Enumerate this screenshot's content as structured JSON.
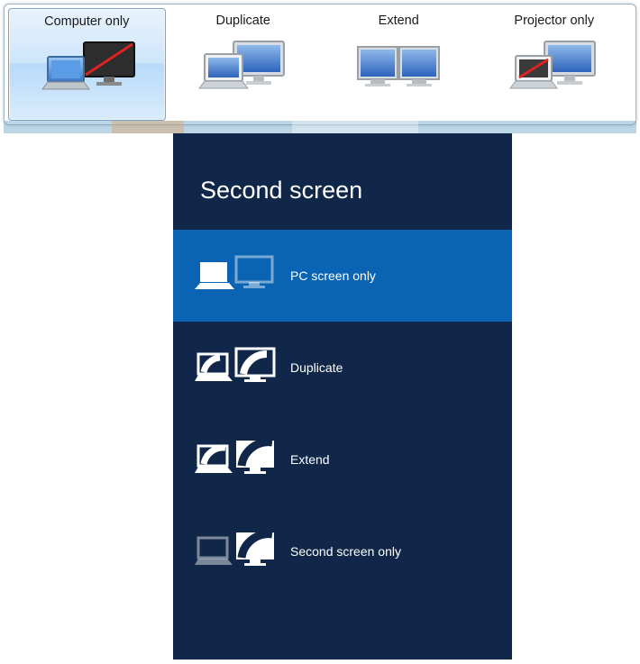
{
  "win7": {
    "options": [
      {
        "label": "Computer only",
        "selected": true
      },
      {
        "label": "Duplicate",
        "selected": false
      },
      {
        "label": "Extend",
        "selected": false
      },
      {
        "label": "Projector only",
        "selected": false
      }
    ]
  },
  "win8": {
    "title": "Second screen",
    "options": [
      {
        "label": "PC screen only",
        "selected": true
      },
      {
        "label": "Duplicate",
        "selected": false
      },
      {
        "label": "Extend",
        "selected": false
      },
      {
        "label": "Second screen only",
        "selected": false
      }
    ]
  }
}
